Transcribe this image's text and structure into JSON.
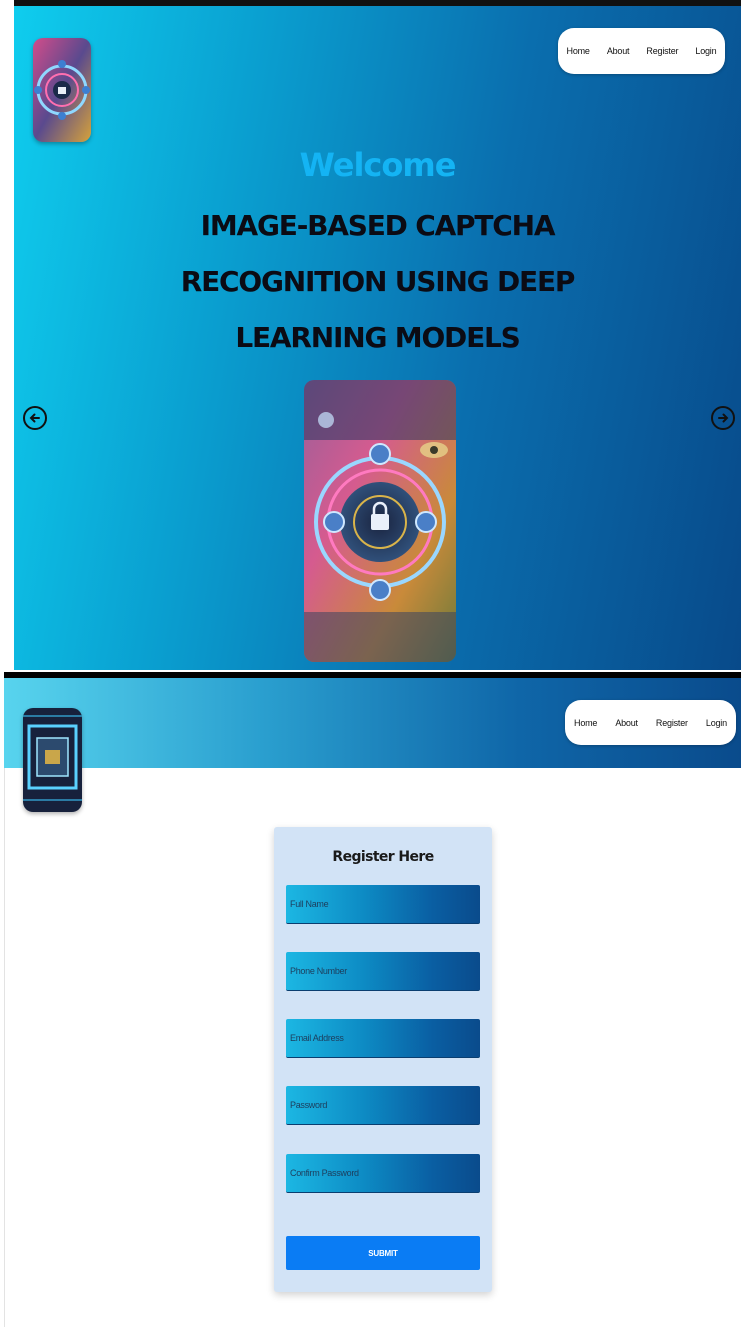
{
  "nav": {
    "items": [
      {
        "label": "Home"
      },
      {
        "label": "About"
      },
      {
        "label": "Register"
      },
      {
        "label": "Login"
      }
    ]
  },
  "hero": {
    "welcome": "Welcome",
    "title": "IMAGE-BASED CAPTCHA RECOGNITION USING DEEP LEARNING MODELS",
    "prev_icon": "arrow-left-icon",
    "next_icon": "arrow-right-icon"
  },
  "register": {
    "title": "Register Here",
    "fields": [
      {
        "placeholder": "Full Name"
      },
      {
        "placeholder": "Phone Number"
      },
      {
        "placeholder": "Email Address"
      },
      {
        "placeholder": "Password"
      },
      {
        "placeholder": "Confirm Password"
      }
    ],
    "submit_label": "SUBMIT"
  },
  "colors": {
    "hero_gradient_start": "#0fcdee",
    "hero_gradient_end": "#084a8a",
    "welcome_text": "#14b4f4",
    "submit_button": "#0a7cf4",
    "card_background": "#d2e3f6"
  }
}
